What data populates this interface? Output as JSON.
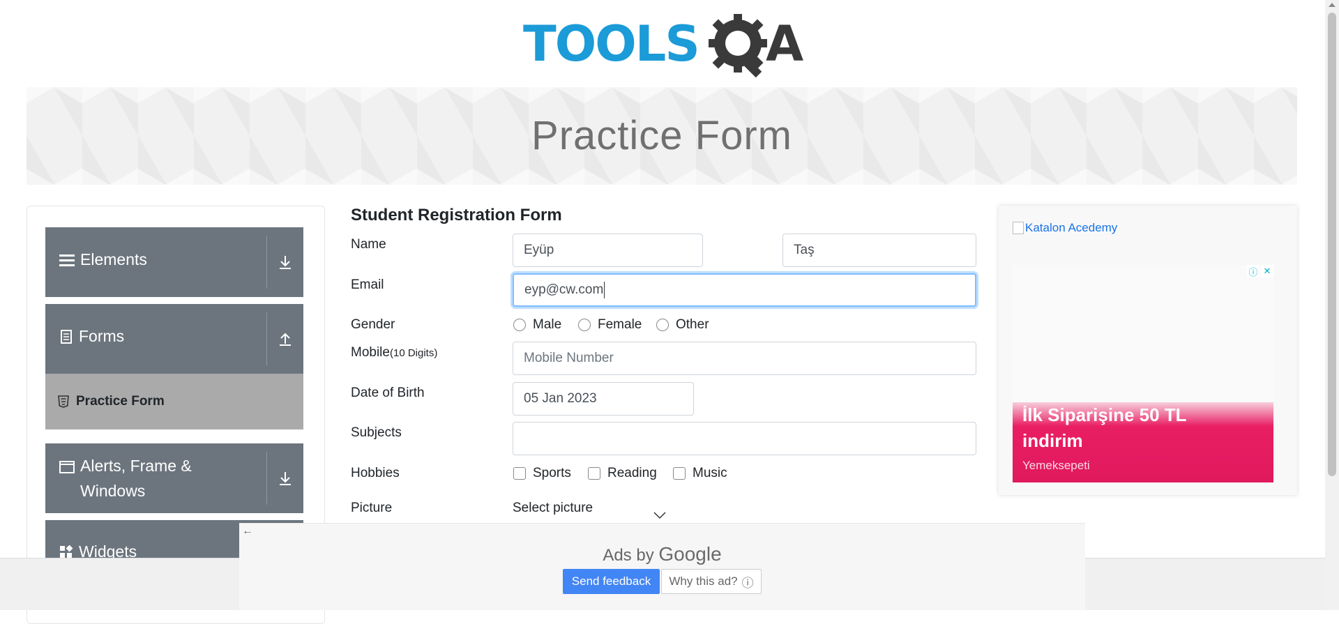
{
  "logo": {
    "text_part": "TOOLS",
    "suffix": "A"
  },
  "banner": {
    "title": "Practice Form"
  },
  "sidebar": {
    "groups": [
      {
        "label": "Elements",
        "icon": "hamburger-icon",
        "toggle": "download-arrow-icon"
      },
      {
        "label": "Forms",
        "icon": "document-icon",
        "toggle": "upload-arrow-icon"
      },
      {
        "label": "Alerts, Frame & Windows",
        "icon": "window-icon",
        "toggle": "download-arrow-icon"
      },
      {
        "label": "Widgets",
        "icon": "widgets-icon"
      }
    ],
    "active_item": {
      "label": "Practice Form",
      "icon": "html5-icon"
    }
  },
  "form": {
    "heading": "Student Registration Form",
    "name": {
      "label": "Name",
      "first": "Eyüp",
      "last": "Taş"
    },
    "email": {
      "label": "Email",
      "value": "eyp@cw.com"
    },
    "gender": {
      "label": "Gender",
      "options": [
        "Male",
        "Female",
        "Other"
      ]
    },
    "mobile": {
      "label": "Mobile",
      "hint": "(10 Digits)",
      "placeholder": "Mobile Number"
    },
    "dob": {
      "label": "Date of Birth",
      "value": "05 Jan 2023"
    },
    "subjects": {
      "label": "Subjects",
      "value": ""
    },
    "hobbies": {
      "label": "Hobbies",
      "options": [
        "Sports",
        "Reading",
        "Music"
      ]
    },
    "picture": {
      "label": "Picture",
      "button": "Select picture"
    }
  },
  "right_ad": {
    "image_alt": "Katalon Acedemy",
    "headline": "İlk Siparişine 50 TL indirim",
    "brand": "Yemeksepeti"
  },
  "google_ad": {
    "ads_by": "Ads by",
    "google": "Google",
    "send_feedback": "Send feedback",
    "why": "Why this ad?"
  }
}
